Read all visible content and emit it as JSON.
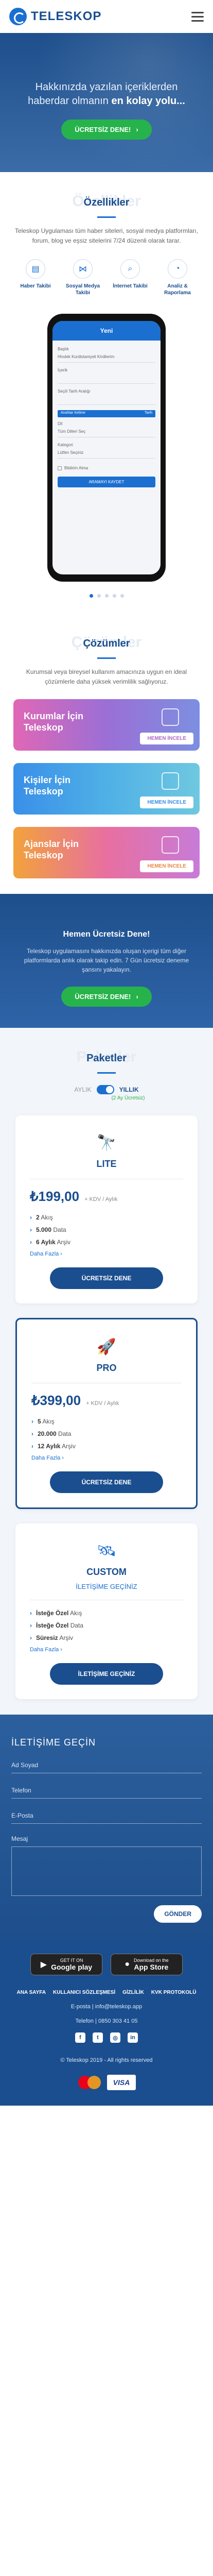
{
  "header": {
    "brand": "TELESKOP"
  },
  "hero": {
    "title_pre": "Hakkınızda yazılan içeriklerden haberdar olmanın",
    "title_bold": "en kolay yolu...",
    "button": "ÜCRETSİZ DENE!"
  },
  "features": {
    "ghost": "Özellikler",
    "title": "Özellikler",
    "text": "Teleskop Uygulaması tüm haber siteleri, sosyal medya platformları, forum, blog ve eşsiz sitelerini 7/24 düzenli olarak tarar.",
    "items": [
      {
        "label": "Haber Takibi",
        "icon": "newspaper-icon"
      },
      {
        "label": "Sosyal Medya Takibi",
        "icon": "share-icon"
      },
      {
        "label": "İnternet Takibi",
        "icon": "search-icon"
      },
      {
        "label": "Analiz & Raporlama",
        "icon": "chart-icon"
      }
    ]
  },
  "phone": {
    "bar": "Yeni",
    "rows": [
      {
        "label": "Başlık",
        "value": "Hindek Kurdistaniyeli Kirdilerim"
      },
      {
        "label": "İçerik",
        "value": ""
      },
      {
        "label": "Seçili Tarih Aralığı",
        "value": ""
      }
    ],
    "head_left": "Anahtar Kelime",
    "head_right": "Tarih",
    "row4_label": "Dil",
    "row4_value": "Tüm Dilleri Seç",
    "row5_label": "Kategori",
    "row5_value": "Lütfen Seçiniz",
    "check": "Bildirim Alma",
    "button": "ARAMAYI KAYDET"
  },
  "solutions": {
    "ghost": "Çözümler",
    "title": "Çözümler",
    "text": "Kurumsal veya bireysel kullanım amacınıza uygun en ideal çözümlerle daha yüksek verimlilik sağlıyoruz.",
    "cards": [
      {
        "title": "Kurumlar İçin Teleskop",
        "more": "HEMEN İNCELE",
        "grad": "linear-gradient(90deg,#e067b5,#9b6fd6,#7c8fe0)",
        "more_color": "#b069c8"
      },
      {
        "title": "Kişiler İçin Teleskop",
        "more": "HEMEN İNCELE",
        "grad": "linear-gradient(90deg,#3a8fe8,#4fb0e6,#6fc8e0)",
        "more_color": "#3a8fe8"
      },
      {
        "title": "Ajanslar İçin Teleskop",
        "more": "HEMEN İNCELE",
        "grad": "linear-gradient(90deg,#f2a23c,#e86fa0,#c77bd8)",
        "more_color": "#e88a4a"
      }
    ]
  },
  "cta": {
    "title": "Hemen Ücretsiz Dene!",
    "text": "Teleskop uygulamasını hakkınızda oluşan içerigi tüm diğer platformlarda anlık olarak takip edin. 7 Gün ücretsiz deneme şansını yakalayın.",
    "button": "ÜCRETSİZ DENE!"
  },
  "pricing": {
    "ghost": "Paketler",
    "title": "Paketler",
    "monthly": "AYLIK",
    "yearly": "YILLIK",
    "save": "(2 Ay Ücretsiz)",
    "plans": [
      {
        "name": "LITE",
        "icon": "telescope-icon",
        "price": "₺199,00",
        "price_note": "+ KDV / Aylık",
        "features": [
          {
            "b": "2",
            "t": "Akış"
          },
          {
            "b": "5.000",
            "t": "Data"
          },
          {
            "b": "6 Aylık",
            "t": "Arşiv"
          }
        ],
        "details": "Daha Fazla ›",
        "button": "ÜCRETSİZ DENE"
      },
      {
        "name": "PRO",
        "icon": "rocket-icon",
        "price": "₺399,00",
        "price_note": "+ KDV / Aylık",
        "features": [
          {
            "b": "5",
            "t": "Akış"
          },
          {
            "b": "20.000",
            "t": "Data"
          },
          {
            "b": "12 Aylık",
            "t": "Arşiv"
          }
        ],
        "details": "Daha Fazla ›",
        "button": "ÜCRETSİZ DENE"
      },
      {
        "name": "CUSTOM",
        "icon": "satellite-icon",
        "sub": "İLETİŞİME GEÇİNİZ",
        "features": [
          {
            "b": "İsteğe Özel",
            "t": "Akış"
          },
          {
            "b": "İsteğe Özel",
            "t": "Data"
          },
          {
            "b": "Süresiz",
            "t": "Arşiv"
          }
        ],
        "details": "Daha Fazla ›",
        "button": "İLETİŞİME GEÇİNİZ"
      }
    ]
  },
  "contact": {
    "title": "İLETİŞİME GEÇİN",
    "name": "Ad Soyad",
    "phone": "Telefon",
    "email": "E-Posta",
    "message": "Mesaj",
    "send": "GÖNDER"
  },
  "footer": {
    "google_small": "GET IT ON",
    "google_big": "Google play",
    "apple_small": "Download on the",
    "apple_big": "App Store",
    "nav": [
      "ANA SAYFA",
      "KULLANICI SÖZLEŞMESİ",
      "GİZLİLİK",
      "KVK PROTOKOLÜ"
    ],
    "email": "E-posta | info@teleskop.app",
    "phone": "Telefon | 0850 303 41 05",
    "copyright": "© Teleskop 2019 - All rights reserved"
  }
}
